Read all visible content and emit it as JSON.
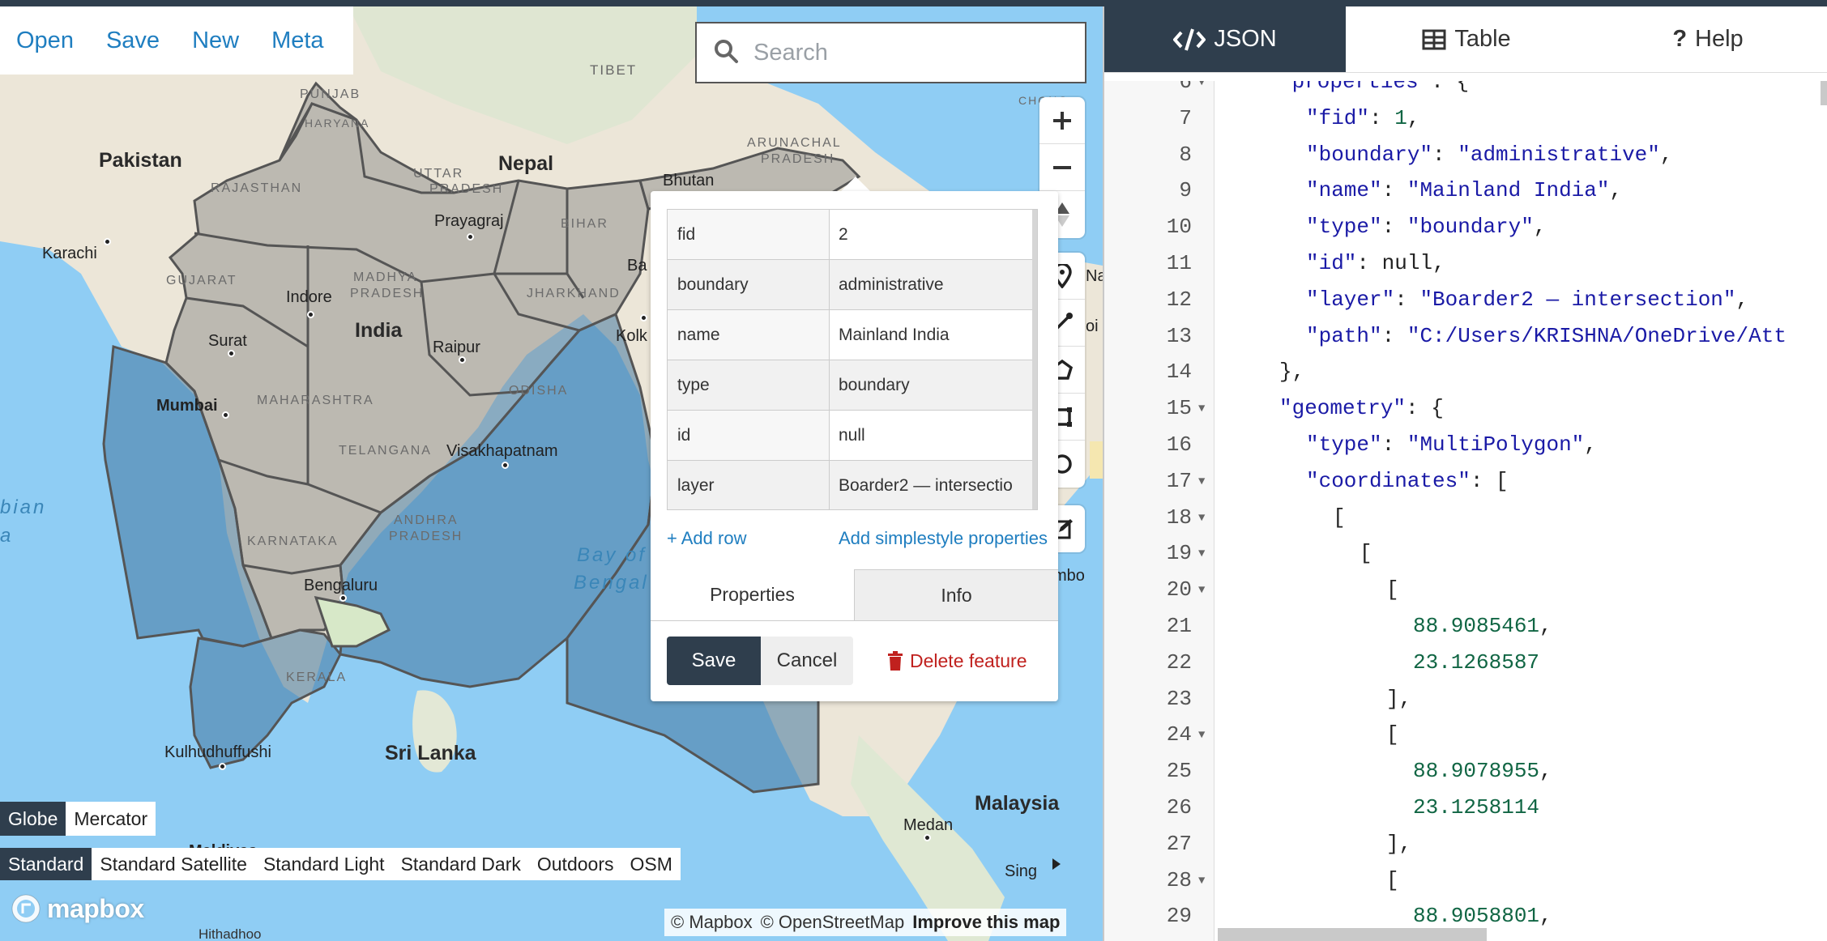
{
  "file_menu": {
    "open": "Open",
    "save": "Save",
    "new": "New",
    "meta": "Meta"
  },
  "search": {
    "placeholder": "Search"
  },
  "map_labels": {
    "countries": {
      "pakistan": "Pakistan",
      "nepal": "Nepal",
      "india": "India",
      "bhutan": "Bhutan",
      "sri_lanka": "Sri Lanka",
      "malaysia": "Malaysia",
      "tibet": "TIBET"
    },
    "cities": {
      "karachi": "Karachi",
      "prayagraj": "Prayagraj",
      "indore": "Indore",
      "surat": "Surat",
      "raipur": "Raipur",
      "mumbai": "Mumbai",
      "visakhapatnam": "Visakhapatnam",
      "bengaluru": "Bengaluru",
      "kulhudhuffushi": "Kulhudhuffushi",
      "medan": "Medan",
      "hithadhoo": "Hithadhoo",
      "kolk": "Kolk",
      "ba": "Ba",
      "sing": "Sing",
      "maldives": "Maldives",
      "na": "Na",
      "oi": "oi",
      "mbo": "mbo",
      "chongqing": "CHONG"
    },
    "states": {
      "punjab": "PUNJAB",
      "haryana": "HARYANA",
      "rajasthan": "RAJASTHAN",
      "uttar_pradesh_1": "UTTAR",
      "uttar_pradesh_2": "PRADESH",
      "bihar": "BIHAR",
      "arunachal_1": "ARUNACHAL",
      "arunachal_2": "PRADESH",
      "gujarat": "GUJARAT",
      "madhya_1": "MADHYA",
      "madhya_2": "PRADESH",
      "jharkhand": "JHARKHAND",
      "maharashtra": "MAHARASHTRA",
      "odisha": "ODISHA",
      "telangana": "TELANGANA",
      "andhra_1": "ANDHRA",
      "andhra_2": "PRADESH",
      "karnataka": "KARNATAKA",
      "kerala": "KERALA"
    },
    "water": {
      "bay_1": "Bay of",
      "bay_2": "Bengal",
      "arabian_1": "bian",
      "arabian_2": "a"
    }
  },
  "properties_table": [
    {
      "key": "fid",
      "value": "2"
    },
    {
      "key": "boundary",
      "value": "administrative"
    },
    {
      "key": "name",
      "value": "Mainland India"
    },
    {
      "key": "type",
      "value": "boundary"
    },
    {
      "key": "id",
      "value": "null"
    },
    {
      "key": "layer",
      "value": "Boarder2 — intersectio"
    }
  ],
  "popup": {
    "add_row": "Add row",
    "add_simplestyle": "Add simplestyle properties",
    "tab_properties": "Properties",
    "tab_info": "Info",
    "save": "Save",
    "cancel": "Cancel",
    "delete": "Delete feature"
  },
  "projection": {
    "globe": "Globe",
    "mercator": "Mercator",
    "active": "Globe"
  },
  "map_styles": {
    "items": [
      "Standard",
      "Standard Satellite",
      "Standard Light",
      "Standard Dark",
      "Outdoors",
      "OSM"
    ],
    "active": "Standard"
  },
  "logo": {
    "text": "mapbox"
  },
  "attribution": {
    "mapbox": "© Mapbox",
    "osm": "© OpenStreetMap",
    "improve": "Improve this map"
  },
  "panel_tabs": {
    "json": "JSON",
    "table": "Table",
    "help": "Help",
    "active": "JSON"
  },
  "editor": {
    "lines": [
      {
        "n": "6",
        "fold": true
      },
      {
        "n": "7",
        "fold": false
      },
      {
        "n": "8",
        "fold": false
      },
      {
        "n": "9",
        "fold": false
      },
      {
        "n": "10",
        "fold": false
      },
      {
        "n": "11",
        "fold": false
      },
      {
        "n": "12",
        "fold": false
      },
      {
        "n": "13",
        "fold": false
      },
      {
        "n": "14",
        "fold": false
      },
      {
        "n": "15",
        "fold": true
      },
      {
        "n": "16",
        "fold": false
      },
      {
        "n": "17",
        "fold": true
      },
      {
        "n": "18",
        "fold": true
      },
      {
        "n": "19",
        "fold": true
      },
      {
        "n": "20",
        "fold": true
      },
      {
        "n": "21",
        "fold": false
      },
      {
        "n": "22",
        "fold": false
      },
      {
        "n": "23",
        "fold": false
      },
      {
        "n": "24",
        "fold": true
      },
      {
        "n": "25",
        "fold": false
      },
      {
        "n": "26",
        "fold": false
      },
      {
        "n": "27",
        "fold": false
      },
      {
        "n": "28",
        "fold": true
      },
      {
        "n": "29",
        "fold": false
      }
    ],
    "code": {
      "l6_key": "\"properties\"",
      "l6_rest": ": {",
      "l7_key": "\"fid\"",
      "l7_val": "1",
      "l7_rest": ",",
      "l8_key": "\"boundary\"",
      "l8_val": "\"administrative\"",
      "l8_rest": ",",
      "l9_key": "\"name\"",
      "l9_val": "\"Mainland India\"",
      "l9_rest": ",",
      "l10_key": "\"type\"",
      "l10_val": "\"boundary\"",
      "l10_rest": ",",
      "l11_key": "\"id\"",
      "l11_val": "null",
      "l11_rest": ",",
      "l12_key": "\"layer\"",
      "l12_val": "\"Boarder2 — intersection\"",
      "l12_rest": ",",
      "l13_key": "\"path\"",
      "l13_val": "\"C:/Users/KRISHNA/OneDrive/Att",
      "l14": "},",
      "l15_key": "\"geometry\"",
      "l15_rest": ": {",
      "l16_key": "\"type\"",
      "l16_val": "\"MultiPolygon\"",
      "l16_rest": ",",
      "l17_key": "\"coordinates\"",
      "l17_rest": ": [",
      "l18": "[",
      "l19": "[",
      "l20": "[",
      "l21": "88.9085461",
      "l22": "23.1268587",
      "l23": "],",
      "l24": "[",
      "l25": "88.9078955",
      "l26": "23.1258114",
      "l27": "],",
      "l28": "[",
      "l29": "88.9058801,"
    }
  },
  "colors": {
    "accent": "#1f7ec0",
    "dark": "#2f3e4d",
    "water": "#8fcdf4",
    "land": "#ece6d8",
    "feature_fill": "#a0a0a0",
    "ocean_feature": "#5f8fb0",
    "delete": "#c0211e"
  }
}
